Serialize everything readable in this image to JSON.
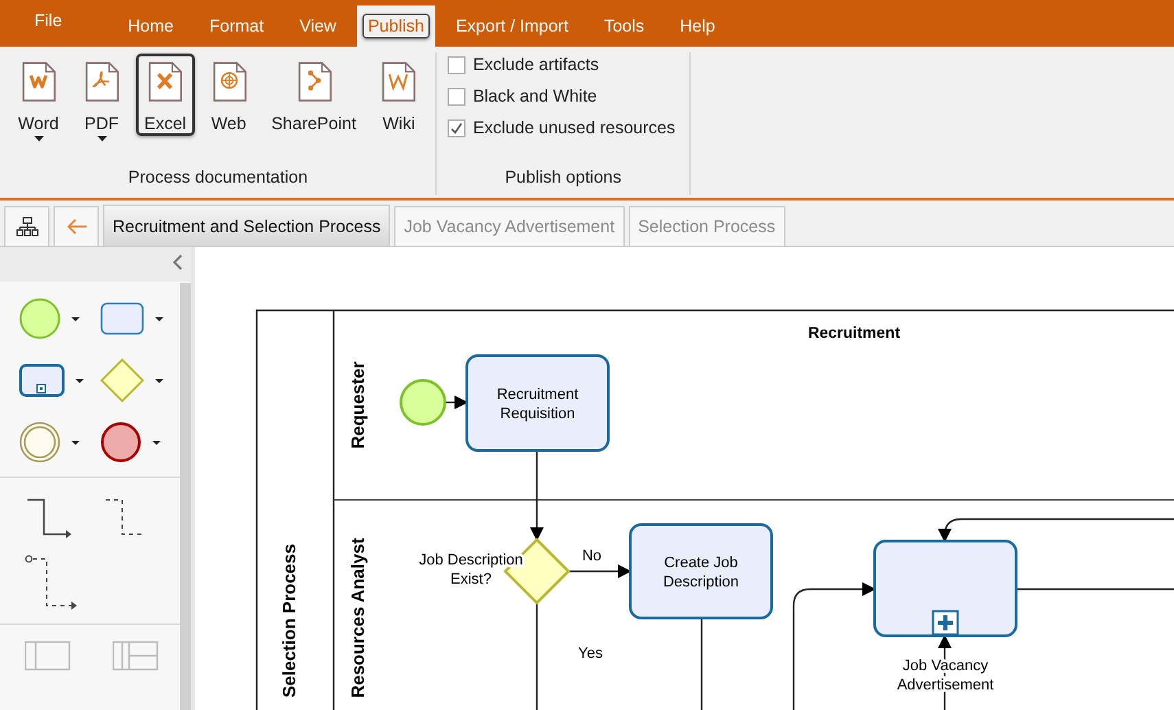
{
  "menu": [
    {
      "label": "File",
      "kind": "file"
    },
    {
      "label": "Home",
      "kind": "tab",
      "selected": false
    },
    {
      "label": "Format",
      "kind": "tab",
      "selected": false
    },
    {
      "label": "View",
      "kind": "tab",
      "selected": false
    },
    {
      "label": "Publish",
      "kind": "tab",
      "selected": true
    },
    {
      "label": "Export / Import",
      "kind": "tab",
      "selected": false
    },
    {
      "label": "Tools",
      "kind": "tab",
      "selected": false
    },
    {
      "label": "Help",
      "kind": "tab",
      "selected": false
    }
  ],
  "ribbon": {
    "groups": [
      {
        "label": "Process documentation",
        "kind": "buttons",
        "buttons": [
          {
            "label": "Word",
            "kind": "word",
            "dropdown": true,
            "selected": false
          },
          {
            "label": "PDF",
            "kind": "pdf",
            "dropdown": true,
            "selected": false
          },
          {
            "label": "Excel",
            "kind": "excel",
            "dropdown": false,
            "selected": true
          },
          {
            "label": "Web",
            "kind": "web",
            "dropdown": false,
            "selected": false
          },
          {
            "label": "SharePoint",
            "kind": "sharepoint",
            "dropdown": false,
            "selected": false
          },
          {
            "label": "Wiki",
            "kind": "wiki",
            "dropdown": false,
            "selected": false
          }
        ]
      },
      {
        "label": "Publish options",
        "kind": "checks",
        "options": [
          {
            "label": "Exclude artifacts",
            "checked": false
          },
          {
            "label": "Black and White",
            "checked": false
          },
          {
            "label": "Exclude unused resources",
            "checked": true
          }
        ]
      }
    ]
  },
  "doc_tabs": [
    {
      "label": "Recruitment and Selection Process",
      "selected": true
    },
    {
      "label": "Job Vacancy Advertisement",
      "selected": false
    },
    {
      "label": "Selection Process",
      "selected": false
    }
  ],
  "diagram": {
    "pool": "Selection Process",
    "header": "Recruitment",
    "lanes": [
      "Requester",
      "Resources Analyst"
    ],
    "nodes": [
      {
        "kind": "start"
      },
      {
        "kind": "task",
        "lines": [
          "Recruitment",
          "Requisition"
        ]
      },
      {
        "kind": "gateway",
        "lines": [
          "Job Description",
          "Exist?"
        ]
      },
      {
        "kind": "task",
        "lines": [
          "Create Job",
          "Description"
        ]
      },
      {
        "kind": "subprocess",
        "lines": [
          "Job Vacancy",
          "Advertisement"
        ]
      }
    ],
    "flow_labels": [
      "No",
      "Yes"
    ]
  }
}
